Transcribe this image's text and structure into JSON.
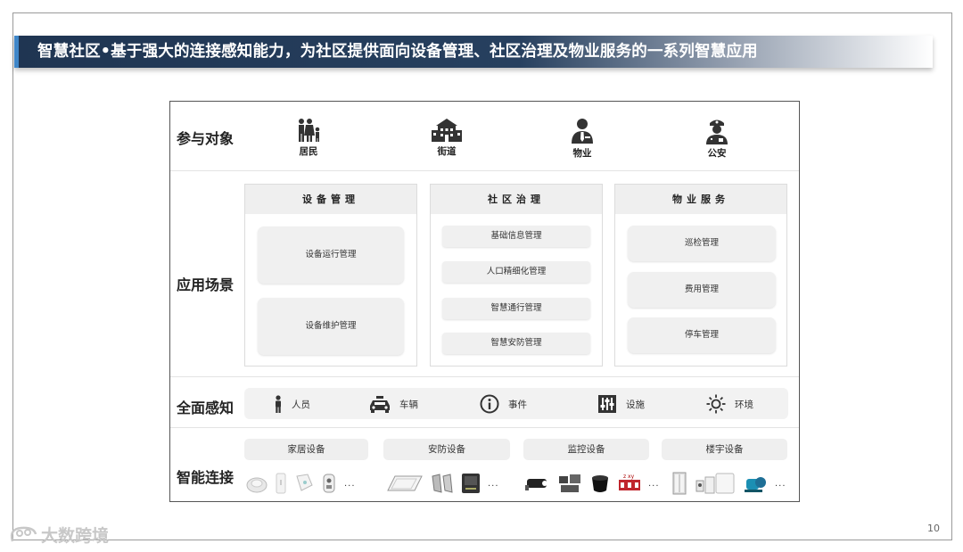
{
  "title": "智慧社区•基于强大的连接感知能力，为社区提供面向设备管理、社区治理及物业服务的一系列智慧应用",
  "rows": {
    "participants": "参与对象",
    "scenarios": "应用场景",
    "sensing": "全面感知",
    "connection": "智能连接"
  },
  "participants": [
    {
      "label": "居民",
      "icon": "family-icon"
    },
    {
      "label": "街道",
      "icon": "building-icon"
    },
    {
      "label": "物业",
      "icon": "manager-icon"
    },
    {
      "label": "公安",
      "icon": "police-icon"
    }
  ],
  "columns": [
    {
      "header": "设备管理",
      "items": [
        "设备运行管理",
        "设备维护管理"
      ]
    },
    {
      "header": "社区治理",
      "items": [
        "基础信息管理",
        "人口精细化管理",
        "智慧通行管理",
        "智慧安防管理"
      ]
    },
    {
      "header": "物业服务",
      "items": [
        "巡检管理",
        "费用管理",
        "停车管理"
      ]
    }
  ],
  "sensing": [
    {
      "label": "人员",
      "icon": "person-icon"
    },
    {
      "label": "车辆",
      "icon": "car-icon"
    },
    {
      "label": "事件",
      "icon": "info-icon"
    },
    {
      "label": "设施",
      "icon": "sliders-icon"
    },
    {
      "label": "环境",
      "icon": "sun-icon"
    }
  ],
  "devices": [
    {
      "label": "家居设备",
      "more": "..."
    },
    {
      "label": "安防设备",
      "more": "..."
    },
    {
      "label": "监控设备",
      "more": "..."
    },
    {
      "label": "楼宇设备",
      "more": "..."
    }
  ],
  "watermark": "大数跨境",
  "page_number": "10"
}
